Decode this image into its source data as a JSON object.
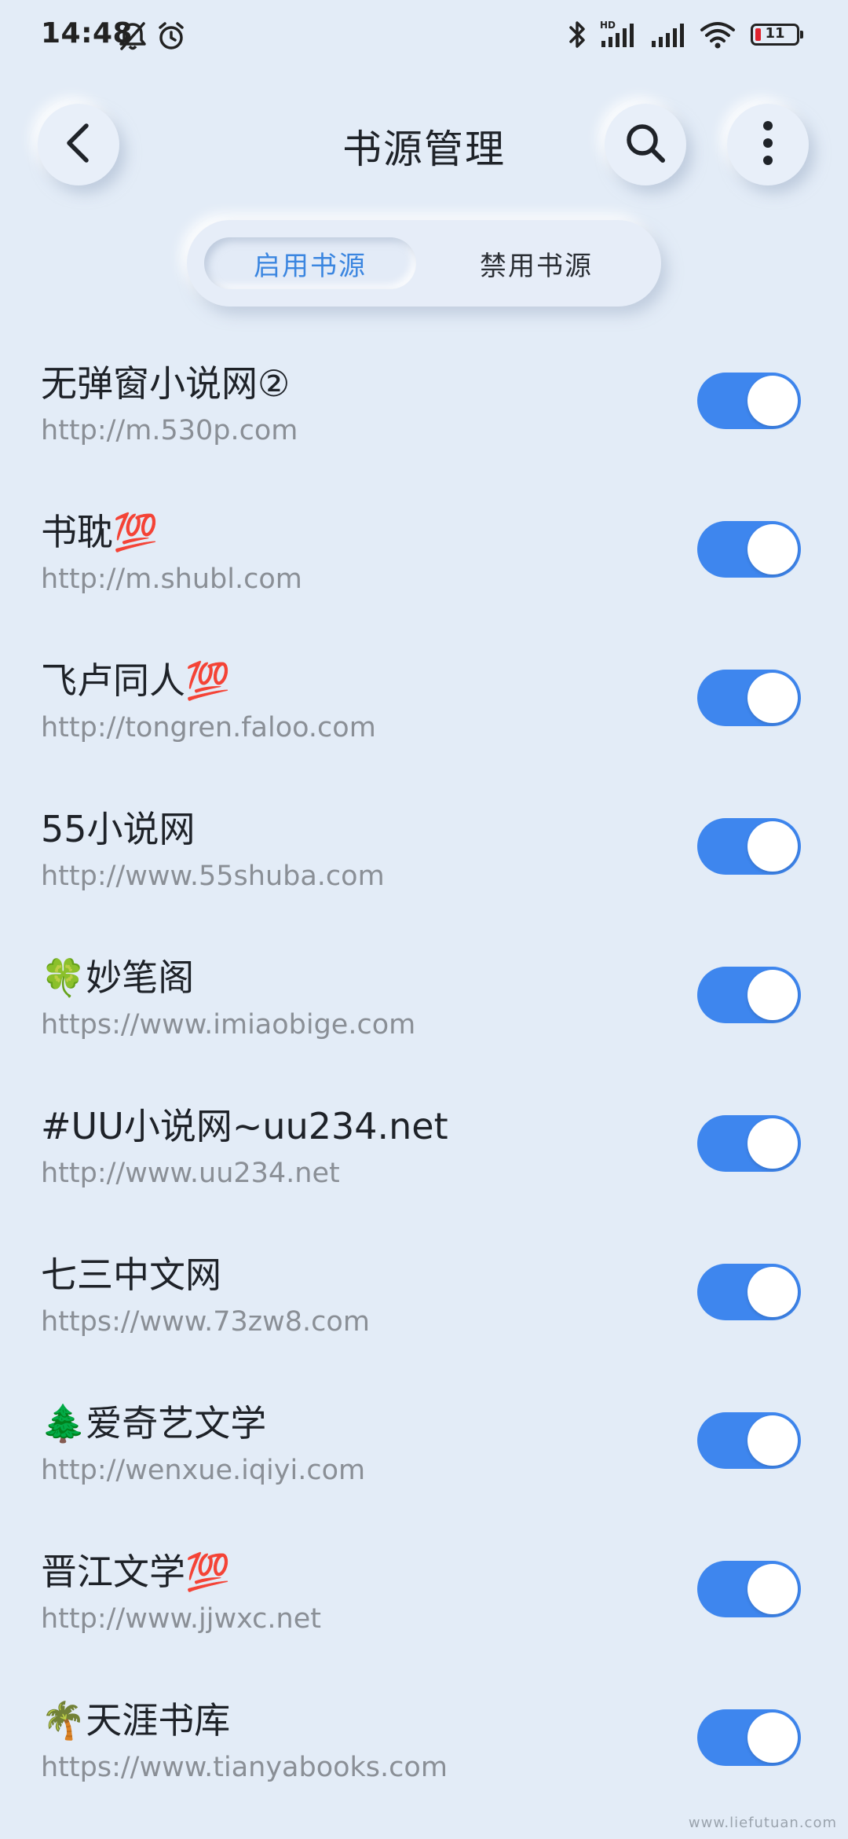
{
  "status_bar": {
    "time": "14:48",
    "battery": "11",
    "icons": [
      "bell-off-icon",
      "alarm-icon",
      "bluetooth-icon",
      "hd-signal-icon",
      "signal-icon",
      "wifi-icon",
      "battery-icon"
    ]
  },
  "header": {
    "title": "书源管理",
    "back_icon": "chevron-left-icon",
    "search_icon": "search-icon",
    "more_icon": "more-vertical-icon"
  },
  "tabs": {
    "enabled": "启用书源",
    "disabled": "禁用书源",
    "active": "enabled"
  },
  "accent_color": "#3e86ee",
  "sources": [
    {
      "name": "无弹窗小说网②",
      "url": "http://m.530p.com",
      "enabled": true
    },
    {
      "name": "书耽💯",
      "url": "http://m.shubl.com",
      "enabled": true
    },
    {
      "name": "飞卢同人💯",
      "url": "http://tongren.faloo.com",
      "enabled": true
    },
    {
      "name": "55小说网",
      "url": "http://www.55shuba.com",
      "enabled": true
    },
    {
      "name": "🍀妙笔阁",
      "url": "https://www.imiaobige.com",
      "enabled": true
    },
    {
      "name": "#UU小说网~uu234.net",
      "url": "http://www.uu234.net",
      "enabled": true
    },
    {
      "name": "七三中文网",
      "url": "https://www.73zw8.com",
      "enabled": true
    },
    {
      "name": "🌲爱奇艺文学",
      "url": "http://wenxue.iqiyi.com",
      "enabled": true
    },
    {
      "name": "晋江文学💯",
      "url": "http://www.jjwxc.net",
      "enabled": true
    },
    {
      "name": "🌴天涯书库",
      "url": "https://www.tianyabooks.com",
      "enabled": true
    }
  ],
  "watermark": "www.liefutuan.com"
}
